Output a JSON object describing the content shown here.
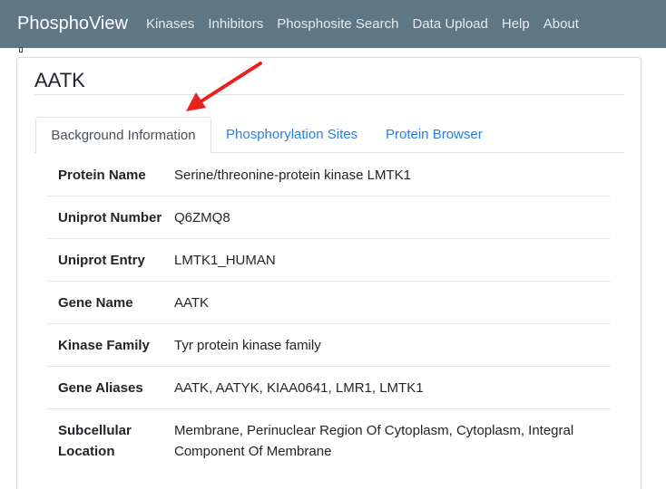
{
  "navbar": {
    "brand": "PhosphoView",
    "links": [
      "Kinases",
      "Inhibitors",
      "Phosphosite Search",
      "Data Upload",
      "Help",
      "About"
    ]
  },
  "page": {
    "title": "AATK"
  },
  "tabs": [
    {
      "label": "Background Information",
      "active": true
    },
    {
      "label": "Phosphorylation Sites",
      "active": false
    },
    {
      "label": "Protein Browser",
      "active": false
    }
  ],
  "info": [
    {
      "label": "Protein Name",
      "value": "Serine/threonine-protein kinase LMTK1"
    },
    {
      "label": "Uniprot Number",
      "value": "Q6ZMQ8"
    },
    {
      "label": "Uniprot Entry",
      "value": "LMTK1_HUMAN"
    },
    {
      "label": "Gene Name",
      "value": "AATK"
    },
    {
      "label": "Kinase Family",
      "value": "Tyr protein kinase family"
    },
    {
      "label": "Gene Aliases",
      "value": "AATK, AATYK, KIAA0641, LMR1, LMTK1"
    },
    {
      "label": "Subcellular Location",
      "value": "Membrane, Perinuclear Region Of Cytoplasm, Cytoplasm, Integral Component Of Membrane"
    }
  ],
  "colors": {
    "navbar_bg": "#5f7684",
    "link": "#2a7de1",
    "arrow": "#e8231f"
  }
}
